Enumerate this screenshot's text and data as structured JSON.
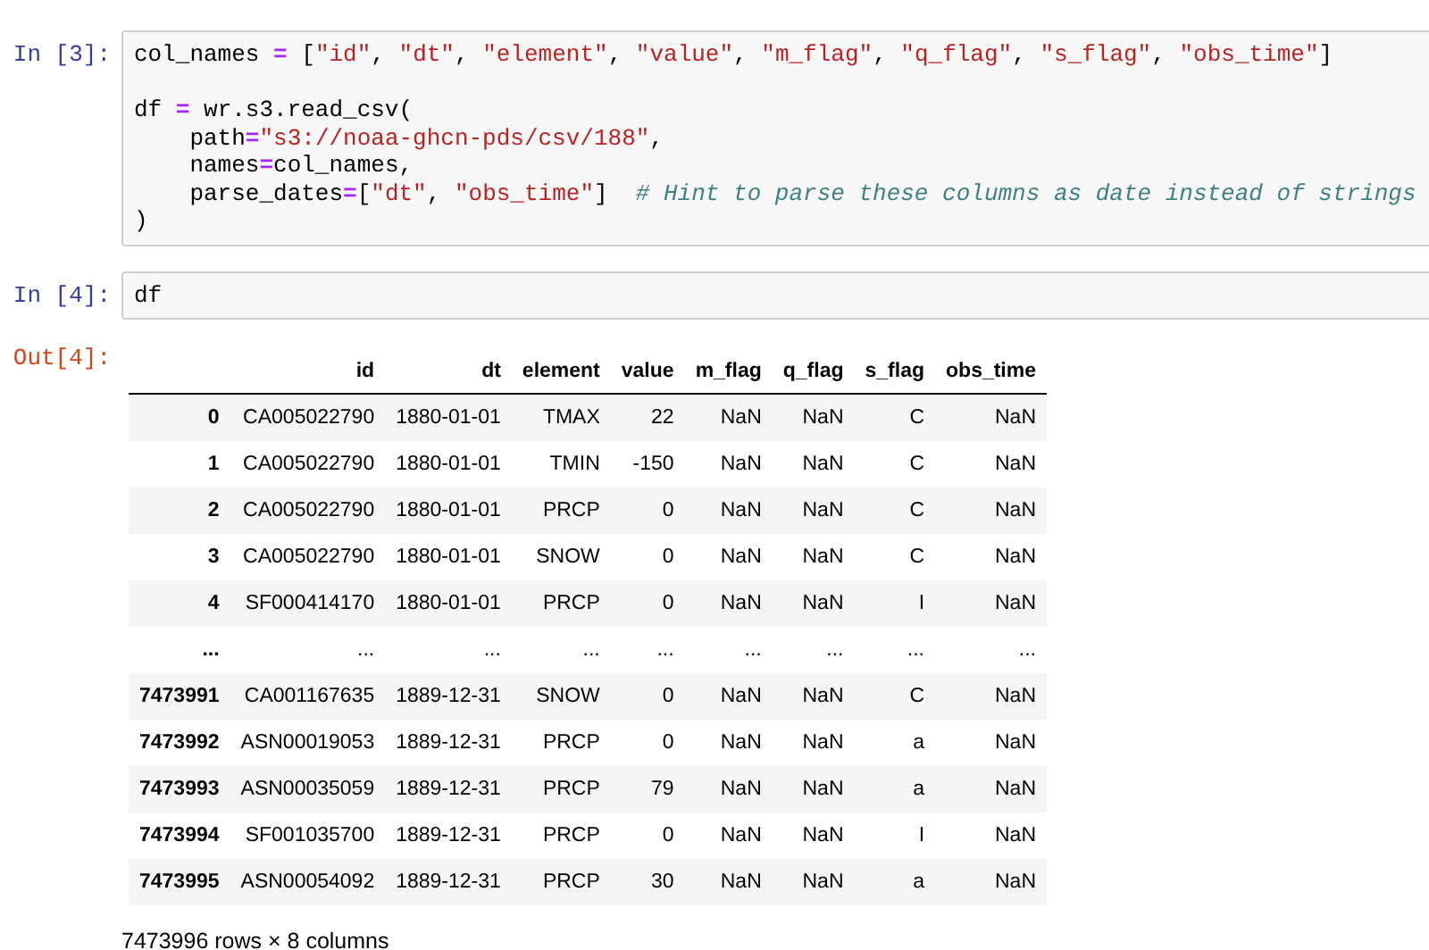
{
  "cells": [
    {
      "prompt": "In [3]:",
      "lines": [
        {
          "tokens": [
            {
              "t": "col_names ",
              "kind": "plain"
            },
            {
              "t": "=",
              "kind": "op"
            },
            {
              "t": " [",
              "kind": "plain"
            },
            {
              "t": "\"id\"",
              "kind": "str"
            },
            {
              "t": ", ",
              "kind": "plain"
            },
            {
              "t": "\"dt\"",
              "kind": "str"
            },
            {
              "t": ", ",
              "kind": "plain"
            },
            {
              "t": "\"element\"",
              "kind": "str"
            },
            {
              "t": ", ",
              "kind": "plain"
            },
            {
              "t": "\"value\"",
              "kind": "str"
            },
            {
              "t": ", ",
              "kind": "plain"
            },
            {
              "t": "\"m_flag\"",
              "kind": "str"
            },
            {
              "t": ", ",
              "kind": "plain"
            },
            {
              "t": "\"q_flag\"",
              "kind": "str"
            },
            {
              "t": ", ",
              "kind": "plain"
            },
            {
              "t": "\"s_flag\"",
              "kind": "str"
            },
            {
              "t": ", ",
              "kind": "plain"
            },
            {
              "t": "\"obs_time\"",
              "kind": "str"
            },
            {
              "t": "]",
              "kind": "plain"
            }
          ]
        },
        {
          "gap_before": true,
          "tokens": [
            {
              "t": "df ",
              "kind": "plain"
            },
            {
              "t": "=",
              "kind": "op"
            },
            {
              "t": " wr.s3.read_csv(",
              "kind": "plain"
            }
          ]
        },
        {
          "tokens": [
            {
              "t": "    path",
              "kind": "plain"
            },
            {
              "t": "=",
              "kind": "op"
            },
            {
              "t": "\"s3://noaa-ghcn-pds/csv/188\"",
              "kind": "str"
            },
            {
              "t": ",",
              "kind": "plain"
            }
          ]
        },
        {
          "tokens": [
            {
              "t": "    names",
              "kind": "plain"
            },
            {
              "t": "=",
              "kind": "op"
            },
            {
              "t": "col_names,",
              "kind": "plain"
            }
          ]
        },
        {
          "tokens": [
            {
              "t": "    parse_dates",
              "kind": "plain"
            },
            {
              "t": "=",
              "kind": "op"
            },
            {
              "t": "[",
              "kind": "plain"
            },
            {
              "t": "\"dt\"",
              "kind": "str"
            },
            {
              "t": ", ",
              "kind": "plain"
            },
            {
              "t": "\"obs_time\"",
              "kind": "str"
            },
            {
              "t": "]  ",
              "kind": "plain"
            },
            {
              "t": "# Hint to parse these columns as date instead of strings",
              "kind": "comment"
            }
          ]
        },
        {
          "tokens": [
            {
              "t": ")",
              "kind": "plain"
            }
          ]
        }
      ]
    },
    {
      "prompt": "In [4]:",
      "lines": [
        {
          "tokens": [
            {
              "t": "df",
              "kind": "plain"
            }
          ]
        }
      ]
    }
  ],
  "output": {
    "prompt": "Out[4]:",
    "table": {
      "columns": [
        "id",
        "dt",
        "element",
        "value",
        "m_flag",
        "q_flag",
        "s_flag",
        "obs_time"
      ],
      "rows": [
        {
          "index": "0",
          "cells": [
            "CA005022790",
            "1880-01-01",
            "TMAX",
            "22",
            "NaN",
            "NaN",
            "C",
            "NaN"
          ]
        },
        {
          "index": "1",
          "cells": [
            "CA005022790",
            "1880-01-01",
            "TMIN",
            "-150",
            "NaN",
            "NaN",
            "C",
            "NaN"
          ]
        },
        {
          "index": "2",
          "cells": [
            "CA005022790",
            "1880-01-01",
            "PRCP",
            "0",
            "NaN",
            "NaN",
            "C",
            "NaN"
          ]
        },
        {
          "index": "3",
          "cells": [
            "CA005022790",
            "1880-01-01",
            "SNOW",
            "0",
            "NaN",
            "NaN",
            "C",
            "NaN"
          ]
        },
        {
          "index": "4",
          "cells": [
            "SF000414170",
            "1880-01-01",
            "PRCP",
            "0",
            "NaN",
            "NaN",
            "I",
            "NaN"
          ]
        },
        {
          "index": "...",
          "cells": [
            "...",
            "...",
            "...",
            "...",
            "...",
            "...",
            "...",
            "..."
          ]
        },
        {
          "index": "7473991",
          "cells": [
            "CA001167635",
            "1889-12-31",
            "SNOW",
            "0",
            "NaN",
            "NaN",
            "C",
            "NaN"
          ]
        },
        {
          "index": "7473992",
          "cells": [
            "ASN00019053",
            "1889-12-31",
            "PRCP",
            "0",
            "NaN",
            "NaN",
            "a",
            "NaN"
          ]
        },
        {
          "index": "7473993",
          "cells": [
            "ASN00035059",
            "1889-12-31",
            "PRCP",
            "79",
            "NaN",
            "NaN",
            "a",
            "NaN"
          ]
        },
        {
          "index": "7473994",
          "cells": [
            "SF001035700",
            "1889-12-31",
            "PRCP",
            "0",
            "NaN",
            "NaN",
            "I",
            "NaN"
          ]
        },
        {
          "index": "7473995",
          "cells": [
            "ASN00054092",
            "1889-12-31",
            "PRCP",
            "30",
            "NaN",
            "NaN",
            "a",
            "NaN"
          ]
        }
      ]
    },
    "shape": "7473996 rows × 8 columns"
  }
}
